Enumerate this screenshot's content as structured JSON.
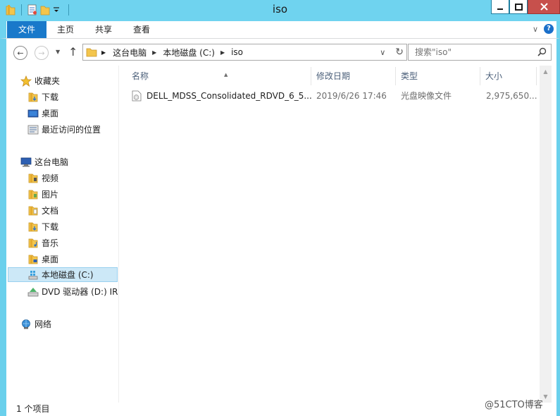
{
  "window": {
    "title": "iso",
    "controls": {
      "minimize": "─",
      "maximize": "□",
      "close": "✕"
    }
  },
  "ribbon": {
    "tabs": [
      "文件",
      "主页",
      "共享",
      "查看"
    ],
    "expand": "∨",
    "help": "?"
  },
  "address": {
    "crumbs": [
      "这台电脑",
      "本地磁盘 (C:)",
      "iso"
    ],
    "dropdown": "∨",
    "refresh": "↻"
  },
  "search": {
    "placeholder": "搜索\"iso\""
  },
  "nav": {
    "favorites_label": "收藏夹",
    "favorites": [
      "下载",
      "桌面",
      "最近访问的位置"
    ],
    "computer_label": "这台电脑",
    "computer": [
      "视频",
      "图片",
      "文档",
      "下载",
      "音乐",
      "桌面",
      "本地磁盘 (C:)",
      "DVD 驱动器 (D:) IR"
    ],
    "network_label": "网络"
  },
  "columns": [
    "名称",
    "修改日期",
    "类型",
    "大小"
  ],
  "files": [
    {
      "name": "DELL_MDSS_Consolidated_RDVD_6_5...",
      "modified": "2019/6/26 17:46",
      "type": "光盘映像文件",
      "size": "2,975,650..."
    }
  ],
  "status": {
    "count": "1 个项目"
  },
  "watermark": "@51CTO博客",
  "colors": {
    "titlebar": "#6fd3ef",
    "file_tab": "#1979ca",
    "selection": "#cce8f7",
    "close": "#c7504c"
  }
}
